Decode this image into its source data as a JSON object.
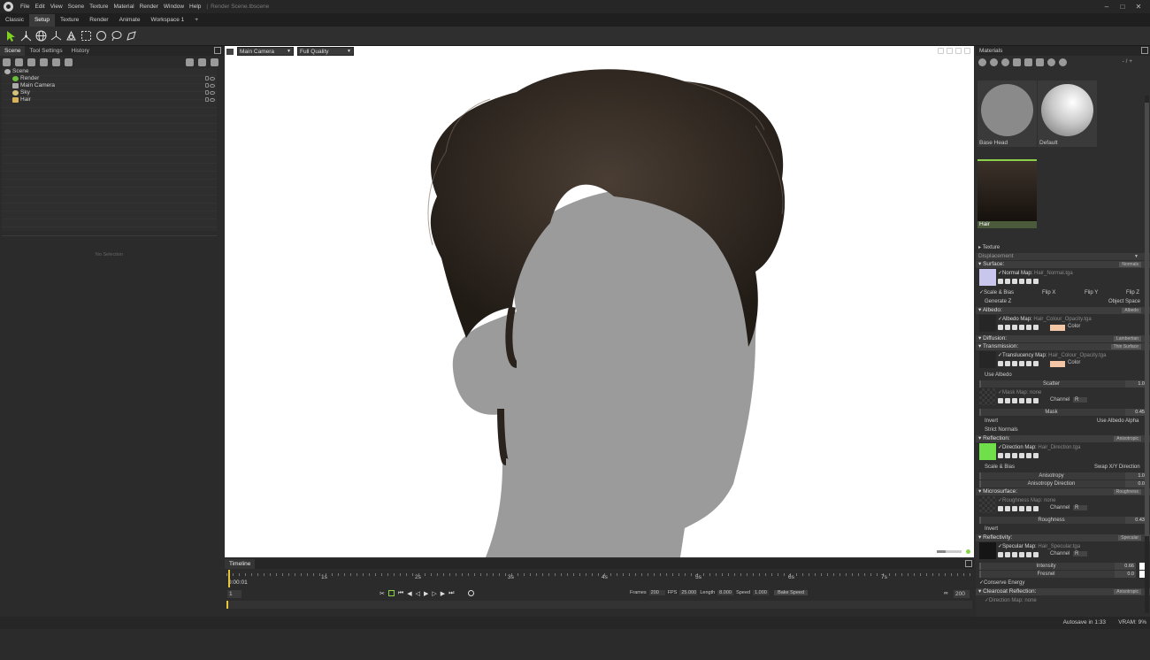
{
  "menubar": {
    "items": [
      "File",
      "Edit",
      "View",
      "Scene",
      "Texture",
      "Material",
      "Render",
      "Window",
      "Help"
    ],
    "document_title": "Render Scene.tbscene"
  },
  "workspace_tabs": [
    "Classic",
    "Setup",
    "Texture",
    "Render",
    "Animate",
    "Workspace 1",
    "+"
  ],
  "active_workspace": "Setup",
  "toolbar": {
    "icons": [
      "select-arrow-icon",
      "transform-icon",
      "globe-icon",
      "axes-icon",
      "camera-rig-icon",
      "marquee-select-icon",
      "circle-select-icon",
      "lasso-icon",
      "paint-select-icon"
    ]
  },
  "left_panel": {
    "tabs": [
      "Scene",
      "Tool Settings",
      "History"
    ],
    "tree": [
      {
        "name": "Scene",
        "indent": 0,
        "color": "#b0b0b0"
      },
      {
        "name": "Render",
        "indent": 1,
        "color": "#6bbf3b"
      },
      {
        "name": "Main Camera",
        "indent": 1,
        "color": "#aaaaaa"
      },
      {
        "name": "Sky",
        "indent": 1,
        "color": "#d8c27a"
      },
      {
        "name": "Hair",
        "indent": 1,
        "color": "#d9b35a"
      }
    ],
    "no_selection": "No Selection"
  },
  "viewport": {
    "camera": "Main Camera",
    "quality": "Full Quality"
  },
  "timeline": {
    "tab": "Timeline",
    "time": "0:00:01",
    "ruler_marks": [
      "1s",
      "2s",
      "3s",
      "4s",
      "5s",
      "6s",
      "7s"
    ],
    "frame_start": "1",
    "frames_label": "Frames",
    "frames": "200",
    "fps_label": "FPS",
    "fps": "25.000",
    "length_label": "Length",
    "length": "8.000",
    "speed_label": "Speed",
    "speed": "1.000",
    "bake_label": "Bake Speed",
    "frame_end": "200"
  },
  "materials": {
    "header": "Materials",
    "paging": "- / +",
    "thumbs": [
      {
        "name": "Base Head"
      },
      {
        "name": "Default"
      },
      {
        "name": "Hair"
      }
    ],
    "texture": "Texture",
    "displacement": "Displacement",
    "surface": {
      "title": "Surface:",
      "mode": "Normals",
      "map_label": "Normal Map:",
      "map_file": "Hair_Normal.tga",
      "scale_bias": "Scale & Bias",
      "flip_x": "Flip X",
      "flip_y": "Flip Y",
      "flip_z": "Flip Z",
      "generate_z": "Generate Z",
      "object_space": "Object Space"
    },
    "albedo": {
      "title": "Albedo:",
      "mode": "Albedo",
      "map_label": "Albedo Map:",
      "map_file": "Hair_Colour_Opacity.tga",
      "color_label": "Color"
    },
    "diffusion": {
      "title": "Diffusion:",
      "mode": "Lambertian"
    },
    "transmission": {
      "title": "Transmission:",
      "mode": "Thin Surface",
      "map_label": "Translucency Map:",
      "map_file": "Hair_Colour_Opacity.tga",
      "color_label": "Color",
      "use_albedo": "Use Albedo",
      "scatter_label": "Scatter",
      "scatter": "1.0",
      "mask_map_label": "Mask Map:",
      "mask_map_file": "none",
      "channel_label": "Channel",
      "channel": "R",
      "mask_label": "Mask",
      "mask": "0.45",
      "invert": "Invert",
      "use_albedo_alpha": "Use Albedo Alpha",
      "strict_normals": "Strict Normals"
    },
    "reflection": {
      "title": "Reflection:",
      "mode": "Anisotropic",
      "map_label": "Direction Map:",
      "map_file": "Hair_Direction.tga",
      "scale_bias": "Scale & Bias",
      "swap": "Swap X/Y Direction",
      "aniso_label": "Anisotropy",
      "aniso": "1.0",
      "aniso_dir_label": "Anisotropy Direction",
      "aniso_dir": "0.0"
    },
    "microsurface": {
      "title": "Microsurface:",
      "mode": "Roughness",
      "map_label": "Roughness Map:",
      "map_file": "none",
      "channel_label": "Channel",
      "channel": "R",
      "rough_label": "Roughness",
      "rough": "0.43",
      "invert": "Invert"
    },
    "reflectivity": {
      "title": "Reflectivity:",
      "mode": "Specular",
      "map_label": "Specular Map:",
      "map_file": "Hair_Specular.tga",
      "channel_label": "Channel",
      "channel": "R",
      "intensity_label": "Intensity",
      "intensity": "0.66",
      "fresnel_label": "Fresnel",
      "fresnel": "0.0",
      "conserve": "Conserve Energy"
    },
    "clearcoat": {
      "title": "Clearcoat Reflection:",
      "mode": "Anisotropic",
      "map_label": "Direction Map:",
      "map_file": "none"
    }
  },
  "status": {
    "autosave": "Autosave in 1:33",
    "vram": "VRAM: 9%"
  },
  "colors": {
    "skin_swatch": "#f3c7a6",
    "accent_green": "#8bd24a",
    "mannequin": "#9b9b9b",
    "hair_dark": "#2e2620"
  }
}
